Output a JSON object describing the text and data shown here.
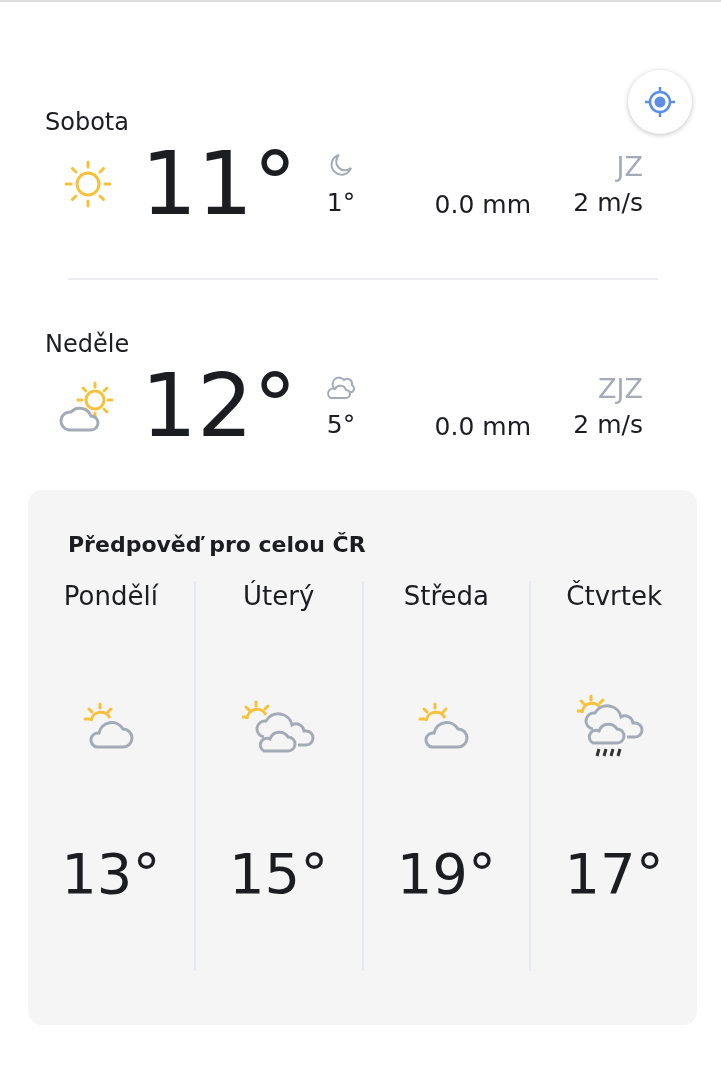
{
  "days": [
    {
      "name": "Sobota",
      "kind": "sun",
      "temp": "11°",
      "night": {
        "kind": "moon",
        "temp": "1°"
      },
      "precipitation": "0.0 mm",
      "wind_direction": "JZ",
      "wind_speed": "2 m/s"
    },
    {
      "name": "Neděle",
      "kind": "sun_cloud",
      "temp": "12°",
      "night": {
        "kind": "clouds",
        "temp": "5°"
      },
      "precipitation": "0.0 mm",
      "wind_direction": "ZJZ",
      "wind_speed": "2 m/s"
    }
  ],
  "forecast": {
    "title": "Předpověď pro celou ČR",
    "days": [
      {
        "name": "Pondělí",
        "kind": "partly_cloudy",
        "temp": "13°"
      },
      {
        "name": "Úterý",
        "kind": "cloudy",
        "temp": "15°"
      },
      {
        "name": "Středa",
        "kind": "partly_cloudy",
        "temp": "19°"
      },
      {
        "name": "Čtvrtek",
        "kind": "rain",
        "temp": "17°"
      }
    ]
  }
}
